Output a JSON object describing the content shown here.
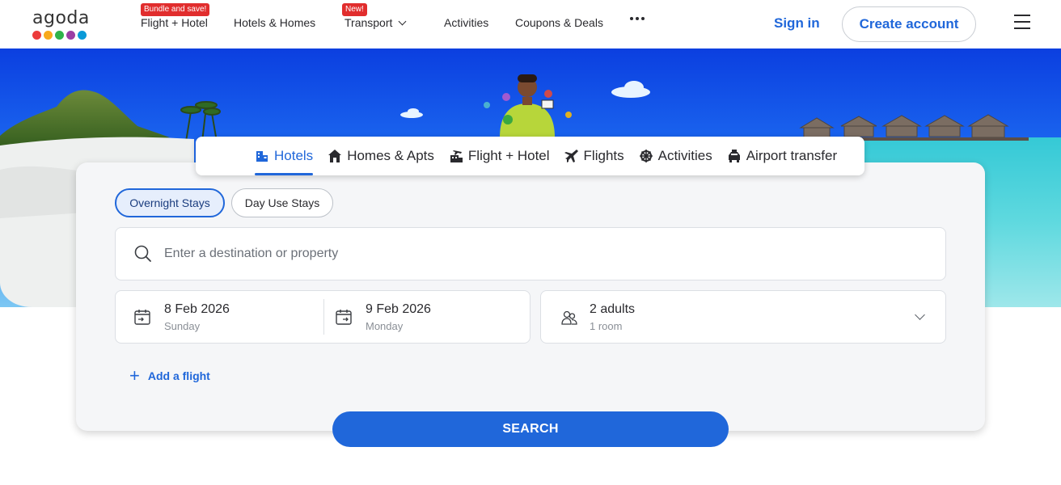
{
  "brand": {
    "logo_text": "agoda",
    "dot_colors": [
      "#ec3b3b",
      "#f8a91b",
      "#2fb34a",
      "#9b3fa4",
      "#0a9ad8"
    ]
  },
  "nav": {
    "items": [
      {
        "label": "Flight + Hotel",
        "badge": "Bundle and save!"
      },
      {
        "label": "Hotels & Homes"
      },
      {
        "label": "Transport",
        "badge": "New!"
      },
      {
        "label": "Activities"
      },
      {
        "label": "Coupons & Deals"
      }
    ],
    "more_icon": "more-horizontal-icon",
    "sign_in": "Sign in",
    "create_account": "Create account",
    "menu_icon": "hamburger-menu-icon"
  },
  "tabs": [
    {
      "label": "Hotels",
      "icon": "hotel-icon",
      "active": true
    },
    {
      "label": "Homes & Apts",
      "icon": "home-icon"
    },
    {
      "label": "Flight + Hotel",
      "icon": "flight-hotel-icon"
    },
    {
      "label": "Flights",
      "icon": "airplane-icon"
    },
    {
      "label": "Activities",
      "icon": "activities-icon"
    },
    {
      "label": "Airport transfer",
      "icon": "car-icon"
    }
  ],
  "search": {
    "stay_types": [
      "Overnight Stays",
      "Day Use Stays"
    ],
    "destination_placeholder": "Enter a destination or property",
    "destination_value": "",
    "check_in": {
      "date": "8 Feb 2026",
      "day": "Sunday"
    },
    "check_out": {
      "date": "9 Feb 2026",
      "day": "Monday"
    },
    "guests": {
      "main": "2 adults",
      "sub": "1 room"
    },
    "add_flight": "Add a flight",
    "button": "SEARCH"
  },
  "colors": {
    "accent": "#2067da",
    "badge_red": "#e12d2d"
  }
}
